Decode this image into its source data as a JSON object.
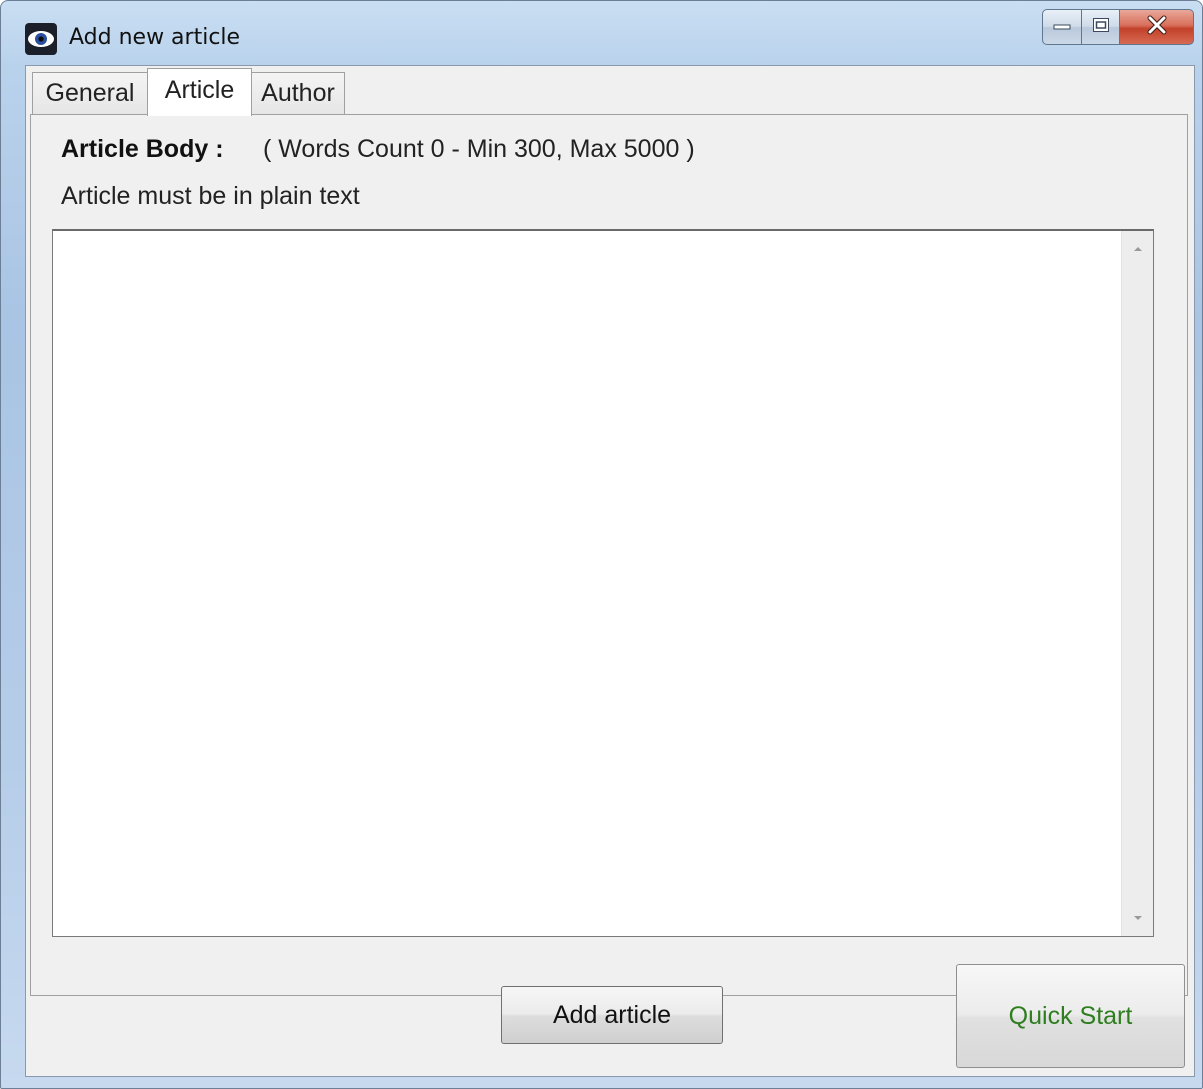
{
  "window": {
    "title": "Add new article",
    "icon": "eye-icon"
  },
  "caption_buttons": {
    "minimize": "minimize-icon",
    "maximize": "maximize-icon",
    "close": "close-icon"
  },
  "tabs": [
    {
      "label": "General",
      "active": false
    },
    {
      "label": "Article",
      "active": true
    },
    {
      "label": "Author",
      "active": false
    }
  ],
  "article": {
    "body_label": "Article Body :",
    "words_count_text": "( Words Count 0 - Min 300, Max 5000 )",
    "plain_text_note": "Article must be in plain text",
    "body_value": ""
  },
  "buttons": {
    "add_article": "Add article",
    "quick_start": "Quick Start"
  },
  "colors": {
    "quick_start_text": "#2e7d1f",
    "close_button": "#c2412a"
  }
}
